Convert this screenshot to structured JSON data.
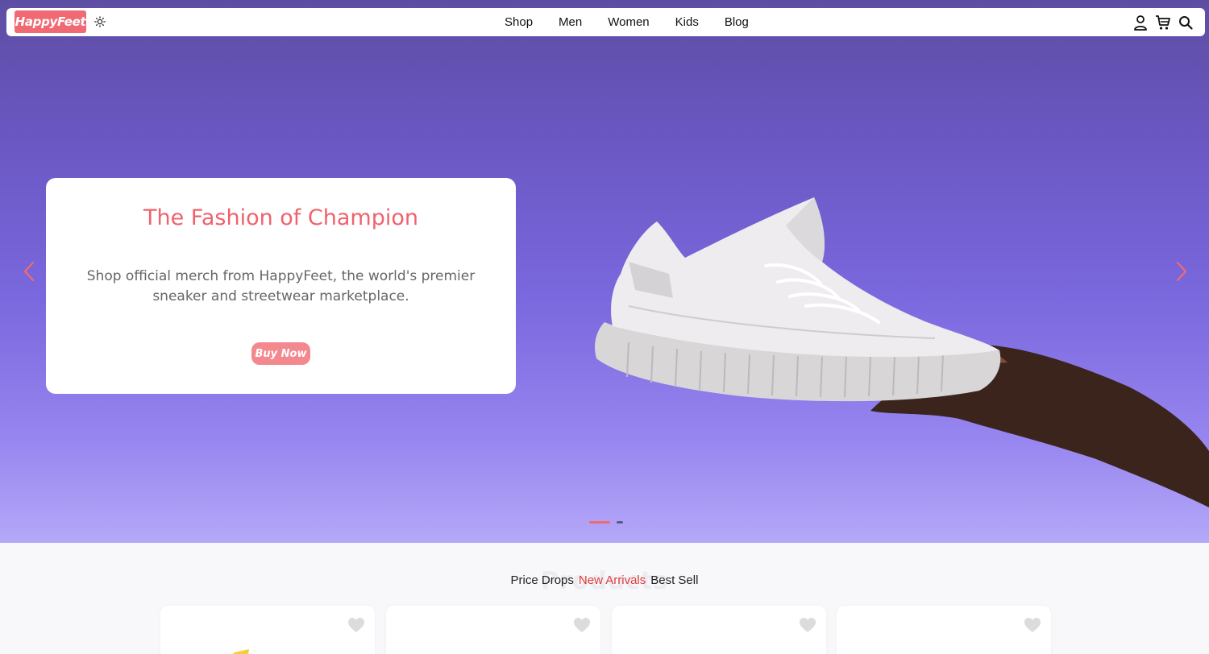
{
  "brand": {
    "logo_text": "HappyFeet"
  },
  "icons": {
    "theme": "sun-icon",
    "account": "user-icon",
    "cart": "cart-icon",
    "search": "search-icon",
    "prev": "chevron-left-icon",
    "next": "chevron-right-icon",
    "wishlist": "heart-icon"
  },
  "nav": {
    "links": [
      "Shop",
      "Men",
      "Women",
      "Kids",
      "Blog"
    ]
  },
  "hero": {
    "title": "The Fashion of Champion",
    "subtitle": "Shop official merch from HappyFeet, the world's premier sneaker and streetwear marketplace.",
    "cta_label": "Buy Now",
    "slide_count": 2,
    "active_slide": 1
  },
  "products": {
    "section_ghost": "Products",
    "tabs": [
      "Price Drops",
      "New Arrivals",
      "Best Sell"
    ],
    "active_tab": "New Arrivals",
    "card_count": 4
  },
  "colors": {
    "accent": "#f06a73",
    "active_tab": "#e23a3a",
    "hero_bg_top": "#5d4ea3",
    "hero_bg_bottom": "#b4a8f8"
  }
}
